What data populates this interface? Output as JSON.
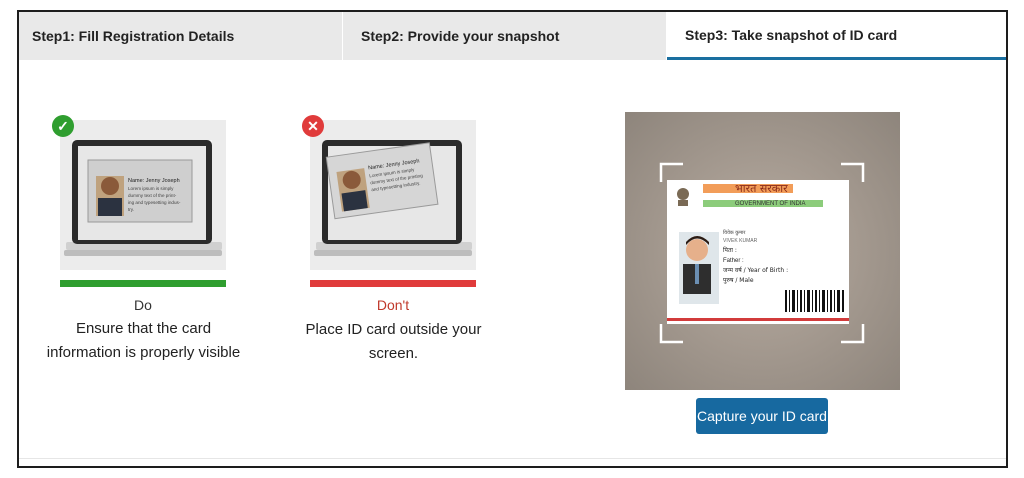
{
  "tabs": [
    {
      "label": "Step1: Fill Registration Details"
    },
    {
      "label": "Step2: Provide your snapshot"
    },
    {
      "label": "Step3: Take snapshot of ID card"
    }
  ],
  "do_panel": {
    "badge_icon": "check-icon",
    "card_name": "Name: Jenny Joseph",
    "card_text": "Lorem ipsum is simply dummy text of the printing and typesetting industry.",
    "caption": "Do",
    "description": "Ensure that the card information is properly visible",
    "bar_color": "#2f9e2f"
  },
  "dont_panel": {
    "badge_icon": "cross-icon",
    "card_name": "Name: Jenny Joseph",
    "card_text": "Lorem ipsum is simply dummy text of the printing and typesetting industry.",
    "caption": "Don't",
    "description": "Place ID card outside your screen.",
    "bar_color": "#e03b3b"
  },
  "id_card": {
    "hindi_header": "भारत सरकार",
    "english_header": "GOVERNMENT OF INDIA",
    "name_hindi": "विवेक कुमार",
    "name_english": "VIVEK KUMAR",
    "father_hindi": "पिता :",
    "father_english": "Father :",
    "dob": "जन्म वर्ष / Year of Birth :",
    "gender": "पुरुष / Male"
  },
  "capture_button": {
    "label": "Capture your ID card"
  },
  "colors": {
    "accent": "#1769a0",
    "do": "#2f9e2f",
    "dont": "#e03b3b"
  }
}
